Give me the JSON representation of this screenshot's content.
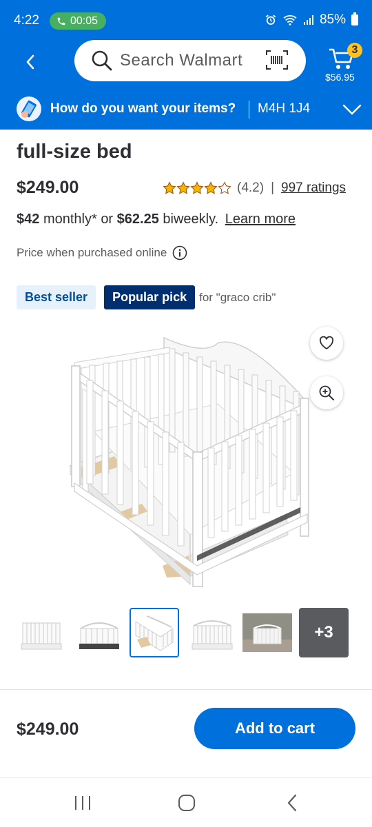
{
  "status_bar": {
    "time": "4:22",
    "call_duration": "00:05",
    "battery": "85%"
  },
  "header": {
    "search_placeholder": "Search Walmart",
    "cart_count": "3",
    "cart_total": "$56.95"
  },
  "delivery": {
    "prompt": "How do you want your items?",
    "postal_code": "M4H 1J4"
  },
  "product": {
    "title": "full-size bed",
    "price": "$249.00",
    "rating_value": "(4.2)",
    "rating_separator": "|",
    "ratings_count": "997 ratings",
    "rating_stars": 4.2,
    "installment_monthly": "$42",
    "installment_monthly_suffix": "monthly*",
    "installment_or": "or",
    "installment_biweekly": "$62.25",
    "installment_biweekly_suffix": "biweekly.",
    "learn_more": "Learn more",
    "price_note": "Price when purchased online",
    "badges": {
      "best_seller": "Best seller",
      "popular_pick": "Popular pick",
      "popular_for": "for \"graco crib\""
    },
    "thumbnails_more": "+3"
  },
  "purchase_bar": {
    "price": "$249.00",
    "add_to_cart": "Add to cart"
  },
  "colors": {
    "brand_blue": "#0071dc",
    "dark_navy": "#002e6e",
    "spark_yellow": "#ffc220"
  }
}
